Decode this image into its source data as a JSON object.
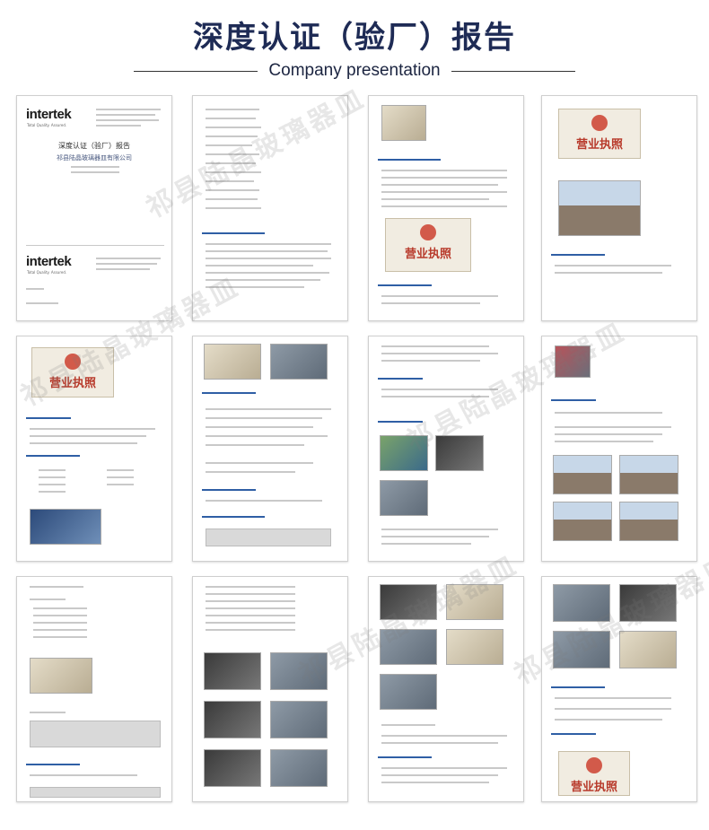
{
  "header": {
    "title": "深度认证（验厂）报告",
    "subtitle": "Company presentation"
  },
  "cover": {
    "brand": "intertek",
    "brand_tag": "Total Quality. Assured.",
    "report_title": "深度认证（验厂）报告",
    "company": "祁县陆晶玻璃器皿有限公司",
    "footer_brand": "intertek",
    "footer_tag": "Total Quality. Assured."
  },
  "license": {
    "text": "营业执照"
  },
  "watermark": {
    "text": "祁县陆晶玻璃器皿"
  }
}
